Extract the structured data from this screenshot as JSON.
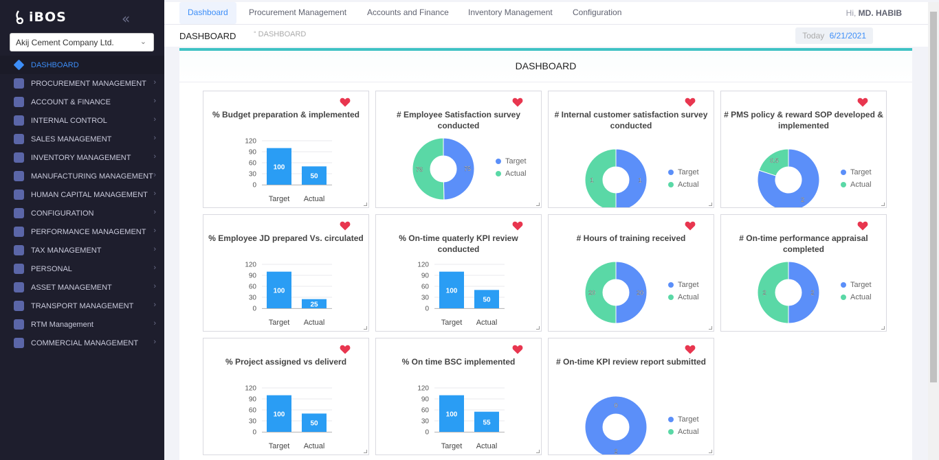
{
  "app": {
    "logo": "iBOS",
    "collapse_icon": "double-chevron-left-icon"
  },
  "company_select": {
    "value": "Akij Cement Company Ltd."
  },
  "sidebar": {
    "items": [
      {
        "label": "DASHBOARD",
        "active": true
      },
      {
        "label": "PROCUREMENT MANAGEMENT"
      },
      {
        "label": "ACCOUNT & FINANCE"
      },
      {
        "label": "INTERNAL CONTROL"
      },
      {
        "label": "SALES MANAGEMENT"
      },
      {
        "label": "INVENTORY MANAGEMENT"
      },
      {
        "label": "MANUFACTURING MANAGEMENT"
      },
      {
        "label": "HUMAN CAPITAL MANAGEMENT"
      },
      {
        "label": "CONFIGURATION"
      },
      {
        "label": "PERFORMANCE MANAGEMENT"
      },
      {
        "label": "TAX MANAGEMENT"
      },
      {
        "label": "PERSONAL"
      },
      {
        "label": "ASSET MANAGEMENT"
      },
      {
        "label": "TRANSPORT MANAGEMENT"
      },
      {
        "label": "RTM Management"
      },
      {
        "label": "COMMERCIAL MANAGEMENT"
      }
    ]
  },
  "topnav": {
    "tabs": [
      "Dashboard",
      "Procurement Management",
      "Accounts and Finance",
      "Inventory Management",
      "Configuration"
    ],
    "greeting": "Hi,",
    "user": "MD. HABIB"
  },
  "subbar": {
    "title": "DASHBOARD",
    "breadcrumb": "DASHBOARD",
    "today_label": "Today",
    "today_date": "6/21/2021"
  },
  "panel": {
    "title": "DASHBOARD"
  },
  "legend": {
    "target": "Target",
    "actual": "Actual"
  },
  "colors": {
    "bar": "#2a9df4",
    "target": "#5b8ff9",
    "actual": "#5ad8a6",
    "heart": "#e8364f",
    "accent": "#3d8ef8",
    "teal": "#3fc2c4"
  },
  "chart_data": [
    {
      "type": "bar",
      "title": "% Budget preparation & implemented",
      "categories": [
        "Target",
        "Actual"
      ],
      "values": [
        100,
        50
      ],
      "yticks": [
        0,
        30,
        60,
        90,
        120
      ],
      "ylim": [
        0,
        120
      ]
    },
    {
      "type": "pie",
      "title": "# Employee Satisfaction survey conducted",
      "labels": [
        "Target",
        "Actual"
      ],
      "values": [
        75,
        76
      ]
    },
    {
      "type": "pie",
      "title": "# Internal customer satisfaction survey conducted",
      "labels": [
        "Target",
        "Actual"
      ],
      "values": [
        1,
        1
      ]
    },
    {
      "type": "pie",
      "title": "# PMS policy & reward SOP developed & implemented",
      "labels": [
        "Target",
        "Actual"
      ],
      "values": [
        2,
        0.5
      ]
    },
    {
      "type": "bar",
      "title": "% Employee JD prepared Vs. circulated",
      "categories": [
        "Target",
        "Actual"
      ],
      "values": [
        100,
        25
      ],
      "yticks": [
        0,
        30,
        60,
        90,
        120
      ],
      "ylim": [
        0,
        120
      ]
    },
    {
      "type": "bar",
      "title": "% On-time quaterly KPI review conducted",
      "categories": [
        "Target",
        "Actual"
      ],
      "values": [
        100,
        50
      ],
      "yticks": [
        0,
        30,
        60,
        90,
        120
      ],
      "ylim": [
        0,
        120
      ]
    },
    {
      "type": "pie",
      "title": "# Hours of training received",
      "labels": [
        "Target",
        "Actual"
      ],
      "values": [
        20,
        20
      ]
    },
    {
      "type": "pie",
      "title": "# On-time performance appraisal completed",
      "labels": [
        "Target",
        "Actual"
      ],
      "values": [
        2,
        2
      ]
    },
    {
      "type": "bar",
      "title": "% Project assigned vs deliverd",
      "categories": [
        "Target",
        "Actual"
      ],
      "values": [
        100,
        50
      ],
      "yticks": [
        0,
        30,
        60,
        90,
        120
      ],
      "ylim": [
        0,
        120
      ]
    },
    {
      "type": "bar",
      "title": "% On time BSC implemented",
      "categories": [
        "Target",
        "Actual"
      ],
      "values": [
        100,
        55
      ],
      "yticks": [
        0,
        30,
        60,
        90,
        120
      ],
      "ylim": [
        0,
        120
      ]
    },
    {
      "type": "pie",
      "title": "# On-time KPI review report submitted",
      "labels": [
        "Target",
        "Actual"
      ],
      "values": [
        2,
        0
      ]
    }
  ]
}
